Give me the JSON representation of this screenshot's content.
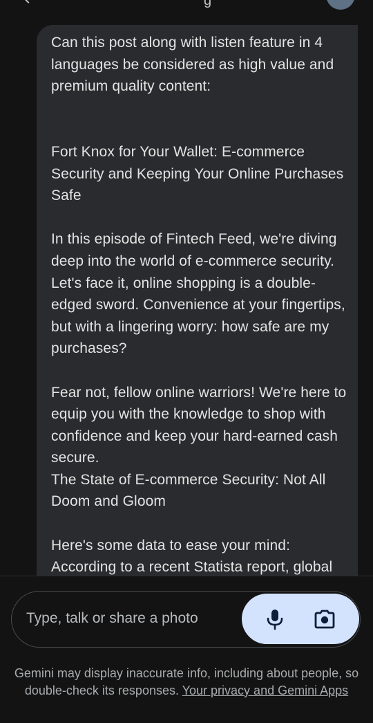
{
  "header": {
    "title_fragment": "g"
  },
  "message": {
    "text": "Can this post along with listen feature in 4 languages be considered as high value and premium quality content:\n\n\nFort Knox for Your Wallet: E-commerce Security and Keeping Your Online Purchases Safe\n\nIn this episode of Fintech Feed, we're diving deep into the world of e-commerce security. Let's face it, online shopping is a double-edged sword. Convenience at your fingertips, but with a lingering worry: how safe are my purchases?\n\nFear not, fellow online warriors! We're here to equip you with the knowledge to shop with confidence and keep your hard-earned cash secure.\nThe State of E-commerce Security: Not All Doom and Gloom\n\nHere's some data to ease your mind:\nAccording to a recent Statista report, global"
  },
  "input": {
    "placeholder": "Type, talk or share a photo"
  },
  "icons": {
    "mic": "microphone-icon",
    "camera": "camera-icon",
    "back": "back-arrow-icon"
  },
  "colors": {
    "background": "#131314",
    "bubble": "#2a2b2e",
    "action_pill": "#d3e3fd",
    "icon": "#0b1f3a"
  },
  "disclaimer": {
    "text": "Gemini may display inaccurate info, including about people, so double-check its responses.",
    "link": "Your privacy and Gemini Apps"
  }
}
